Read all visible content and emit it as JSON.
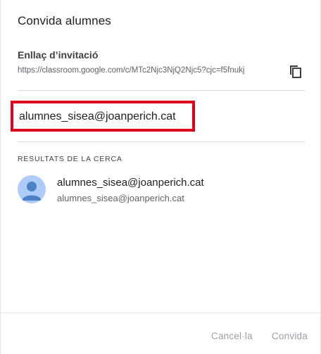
{
  "dialog": {
    "title": "Convida alumnes"
  },
  "invite_link": {
    "label": "Enllaç d’invitació",
    "url": "https://classroom.google.com/c/MTc2Njc3NjQ2Njc5?cjc=f5fnukj",
    "copy_icon": "copy-icon"
  },
  "search": {
    "value": "alumnes_sisea@joanperich.cat",
    "highlight_color": "#e0001b"
  },
  "results": {
    "header": "RESULTATS DE LA CERCA",
    "items": [
      {
        "name": "alumnes_sisea@joanperich.cat",
        "email": "alumnes_sisea@joanperich.cat",
        "avatar_icon": "person-avatar-icon"
      }
    ]
  },
  "footer": {
    "cancel_label": "Cancel·la",
    "invite_label": "Convida"
  }
}
